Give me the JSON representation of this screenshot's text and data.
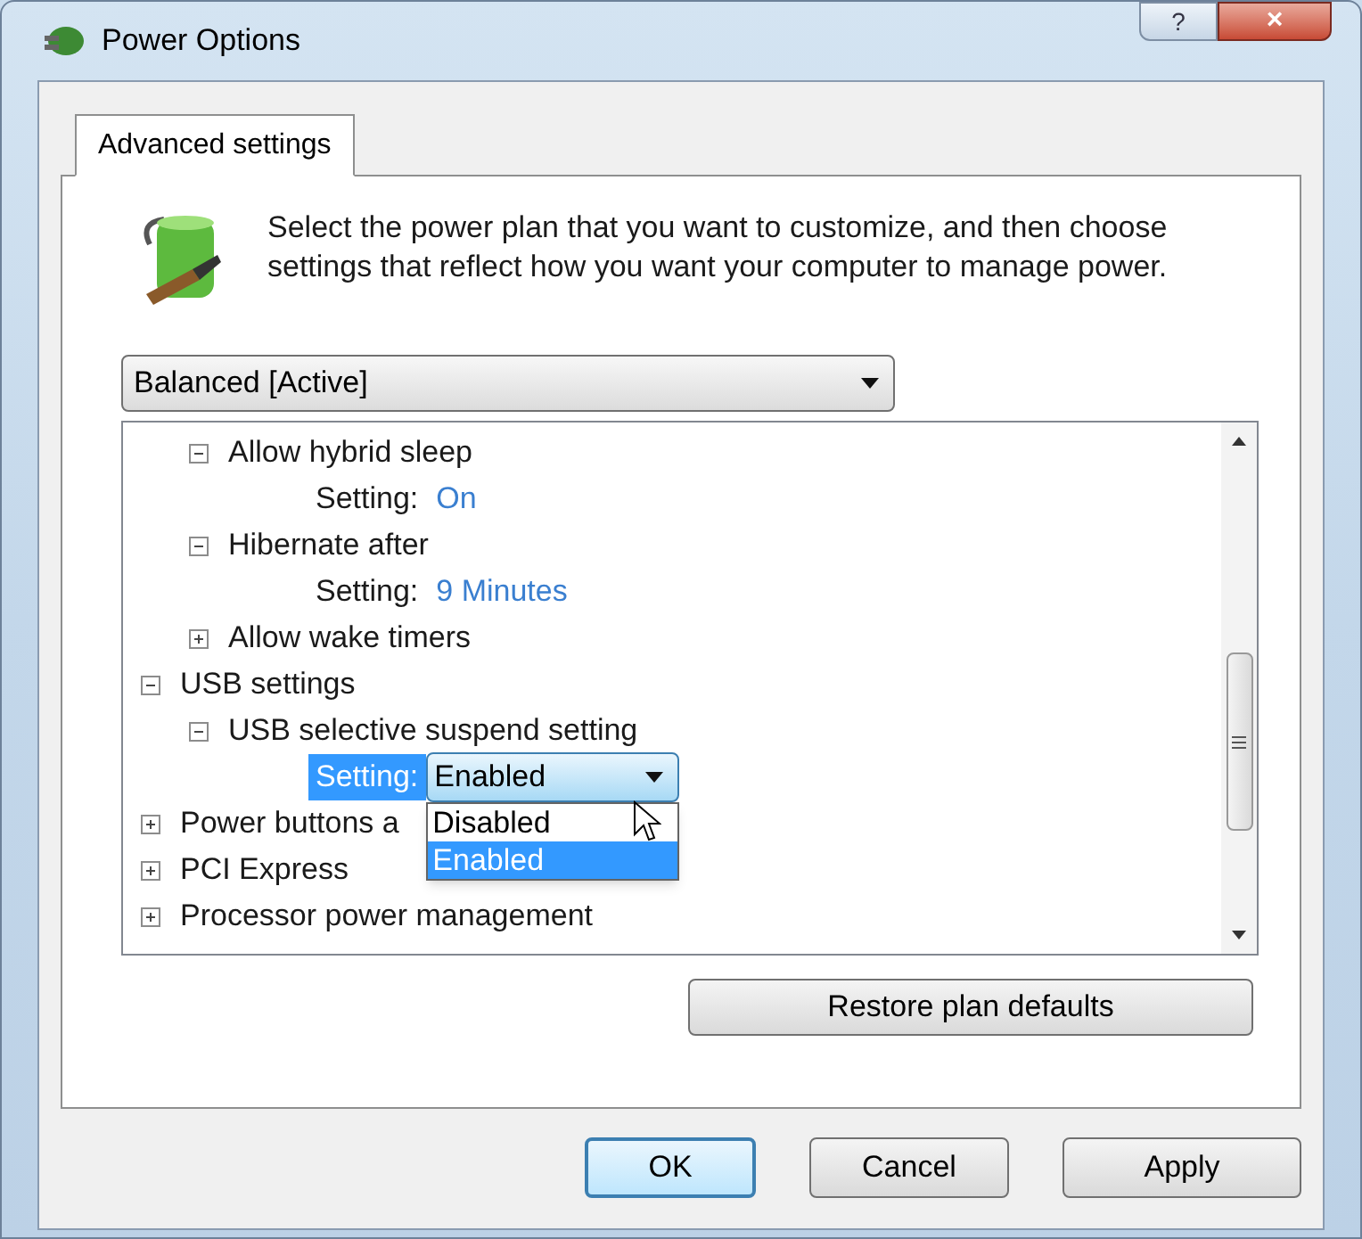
{
  "window": {
    "title": "Power Options",
    "help_button": "?",
    "close_button": "×"
  },
  "tabs": [
    {
      "label": "Advanced settings",
      "selected": true
    }
  ],
  "intro": "Select the power plan that you want to customize, and then choose settings that reflect how you want your computer to manage power.",
  "plan_select": {
    "value": "Balanced [Active]"
  },
  "tree": {
    "items": [
      {
        "kind": "continued",
        "children": [
          {
            "kind": "group",
            "label": "Allow hybrid sleep",
            "expanded": true,
            "children": [
              {
                "kind": "setting",
                "label": "Setting:",
                "value": "On",
                "selected": false
              }
            ]
          },
          {
            "kind": "group",
            "label": "Hibernate after",
            "expanded": true,
            "children": [
              {
                "kind": "setting",
                "label": "Setting:",
                "value": "9 Minutes",
                "selected": false
              }
            ]
          },
          {
            "kind": "group",
            "label": "Allow wake timers",
            "expanded": false
          }
        ]
      },
      {
        "kind": "group",
        "label": "USB settings",
        "expanded": true,
        "children": [
          {
            "kind": "group",
            "label": "USB selective suspend setting",
            "expanded": true,
            "children": [
              {
                "kind": "setting",
                "label": "Setting:",
                "value": "Enabled",
                "selected": true,
                "options": [
                  {
                    "label": "Disabled",
                    "selected": false
                  },
                  {
                    "label": "Enabled",
                    "selected": true
                  }
                ]
              }
            ]
          }
        ]
      },
      {
        "kind": "group",
        "label": "Power buttons a",
        "expanded": false
      },
      {
        "kind": "group",
        "label": "PCI Express",
        "expanded": false
      },
      {
        "kind": "group",
        "label": "Processor power management",
        "expanded": false
      }
    ]
  },
  "restore_button": "Restore plan defaults",
  "buttons": [
    {
      "label": "OK",
      "kind": "default"
    },
    {
      "label": "Cancel",
      "kind": "normal"
    },
    {
      "label": "Apply",
      "kind": "normal"
    }
  ]
}
